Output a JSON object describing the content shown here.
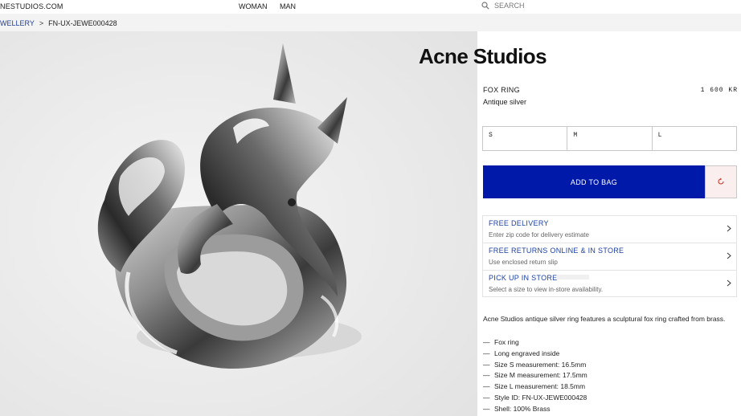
{
  "header": {
    "site_name": "NESTUDIOS.COM",
    "nav": [
      "WOMAN",
      "MAN"
    ],
    "search_placeholder": "SEARCH"
  },
  "breadcrumb": {
    "parent": "WELLERY",
    "separator": ">",
    "current": "FN-UX-JEWE000428"
  },
  "brand": {
    "logo": "Acne Studios"
  },
  "product": {
    "name": "FOX RING",
    "color": "Antique silver",
    "price": "1 600 KR",
    "sizes": [
      "S",
      "M",
      "L"
    ],
    "add_to_bag": "ADD TO BAG",
    "image_icon": "silver-fox-ring-photo"
  },
  "info": [
    {
      "title": "FREE DELIVERY",
      "subtitle": "Enter zip code for delivery estimate"
    },
    {
      "title": "FREE RETURNS ONLINE & IN STORE",
      "subtitle": "Use enclosed return slip"
    },
    {
      "title": "PICK UP IN STORE",
      "subtitle": "Select a size to view in-store availability."
    }
  ],
  "description": "Acne Studios antique silver ring features a sculptural fox ring crafted from brass.",
  "features": [
    "Fox ring",
    "Long engraved inside",
    "Size S measurement: 16.5mm",
    "Size M measurement: 17.5mm",
    "Size L measurement: 18.5mm",
    "Style ID: FN-UX-JEWE000428",
    "Shell: 100% Brass"
  ],
  "feature_bullet": "—",
  "colors": {
    "accent": "#0019a8",
    "link": "#1b3fa3",
    "refresh": "#c0392b"
  }
}
